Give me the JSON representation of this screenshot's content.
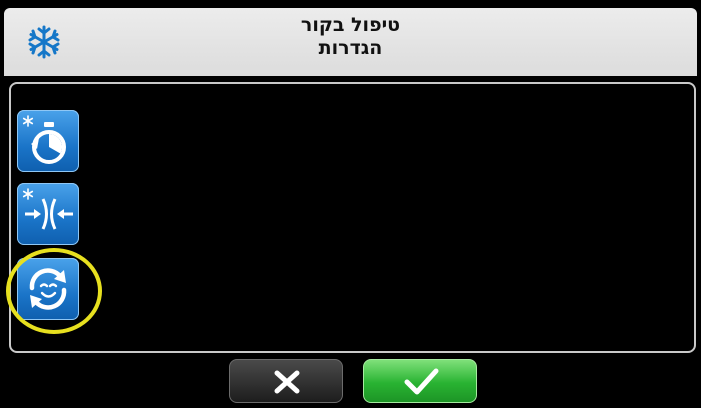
{
  "header": {
    "title_line1": "טיפול בקור",
    "title_line2": "הגדרות",
    "icon": "snowflake-icon"
  },
  "settings_tiles": [
    {
      "icon": "cold-timer-icon"
    },
    {
      "icon": "cold-compress-icon"
    },
    {
      "icon": "cycle-face-icon"
    }
  ],
  "highlighted_tile": 3,
  "buttons": {
    "cancel_icon": "close-icon",
    "confirm_icon": "check-icon"
  },
  "colors": {
    "tile_blue": "#1a74c8",
    "highlight_yellow": "#e7e01f",
    "confirm_green": "#29b332",
    "header_bg": "#e6e6e6"
  }
}
